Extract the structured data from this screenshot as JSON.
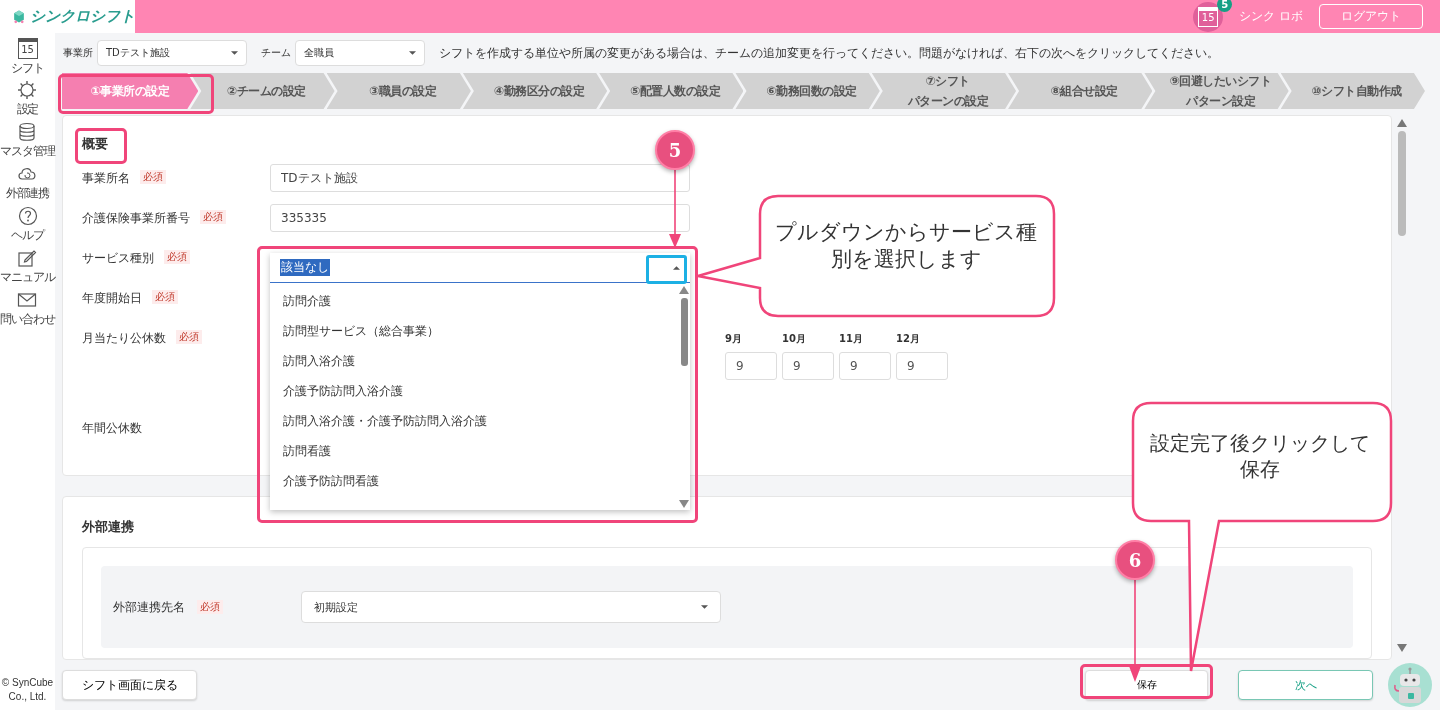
{
  "header": {
    "logo_text": "シンクロシフト",
    "calendar_day": "15",
    "notification_count": "5",
    "user_name": "シンク ロボ",
    "logout_button": "ログアウト"
  },
  "sidebar": {
    "items": [
      {
        "kind": "calendar",
        "label": "シフト",
        "day": "15"
      },
      {
        "kind": "gear",
        "label": "設定"
      },
      {
        "kind": "database",
        "label": "マスタ管理"
      },
      {
        "kind": "cloud",
        "label": "外部連携"
      },
      {
        "kind": "help",
        "label": "ヘルプ"
      },
      {
        "kind": "edit",
        "label": "マニュアル"
      },
      {
        "kind": "mail",
        "label": "問い合わせ"
      }
    ],
    "copyright": "© SynCube Co., Ltd."
  },
  "filters": [
    {
      "label": "事業所",
      "value": "TDテスト施設"
    },
    {
      "label": "チーム",
      "value": "全職員"
    }
  ],
  "instruction": "シフトを作成する単位や所属の変更がある場合は、チームの追加変更を行ってください。問題がなければ、右下の次へをクリックしてください。",
  "steps": [
    {
      "lines": [
        "①事業所の設定"
      ],
      "selected": true
    },
    {
      "lines": [
        "②チームの設定"
      ],
      "selected": false
    },
    {
      "lines": [
        "③職員の設定"
      ],
      "selected": false
    },
    {
      "lines": [
        "④勤務区分の設定"
      ],
      "selected": false
    },
    {
      "lines": [
        "⑤配置人数の設定"
      ],
      "selected": false
    },
    {
      "lines": [
        "⑥勤務回数の設定"
      ],
      "selected": false
    },
    {
      "lines": [
        "⑦シフト",
        "パターンの設定"
      ],
      "selected": false
    },
    {
      "lines": [
        "⑧組合せ設定"
      ],
      "selected": false
    },
    {
      "lines": [
        "⑨回避したいシフト",
        "パターン設定"
      ],
      "selected": false
    },
    {
      "lines": [
        "⑩シフト自動作成"
      ],
      "selected": false
    }
  ],
  "overview": {
    "title": "概要",
    "fields": [
      {
        "kind": "text",
        "label": "事業所名",
        "badge": "必須",
        "value": "TDテスト施設"
      },
      {
        "kind": "text",
        "label": "介護保険事業所番号",
        "badge": "必須",
        "value": "335335"
      },
      {
        "kind": "dropdown",
        "label": "サービス種別",
        "badge": "必須"
      },
      {
        "kind": "covered",
        "label": "年度開始日",
        "badge": "必須"
      },
      {
        "kind": "months",
        "label": "月当たり公休数",
        "badge": "必須",
        "months": [
          {
            "month": "9月",
            "value": "9"
          },
          {
            "month": "10月",
            "value": "9"
          },
          {
            "month": "11月",
            "value": "9"
          },
          {
            "month": "12月",
            "value": "9"
          }
        ]
      },
      {
        "kind": "covered",
        "label": "年間公休数"
      }
    ]
  },
  "service_dropdown": {
    "value": "該当なし",
    "expanded": true,
    "options": [
      "訪問介護",
      "訪問型サービス（総合事業）",
      "訪問入浴介護",
      "介護予防訪問入浴介護",
      "訪問入浴介護・介護予防訪問入浴介護",
      "訪問看護",
      "介護予防訪問看護"
    ]
  },
  "external": {
    "title": "外部連携",
    "fields": [
      {
        "label": "外部連携先名",
        "badge": "必須",
        "value": "初期設定"
      }
    ]
  },
  "footer": {
    "back_button": "シフト画面に戻る",
    "save_button": "保存",
    "next_button": "次へ"
  },
  "annotations": {
    "markers": [
      "5",
      "6"
    ],
    "callouts": [
      "プルダウンからサービス種別を選択します",
      "設定完了後クリックして保存"
    ]
  }
}
